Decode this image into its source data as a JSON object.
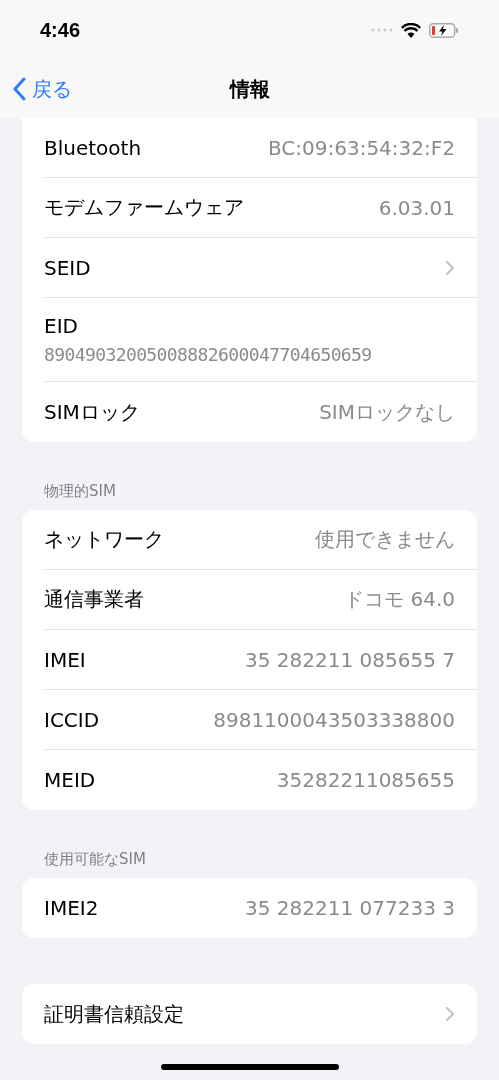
{
  "status_bar": {
    "time": "4:46"
  },
  "nav": {
    "back": "戻る",
    "title": "情報"
  },
  "sections": [
    {
      "cut_top": true,
      "rows": [
        {
          "kind": "value",
          "label": "Bluetooth",
          "value": "BC:09:63:54:32:F2"
        },
        {
          "kind": "value",
          "label": "モデムファームウェア",
          "value": "6.03.01"
        },
        {
          "kind": "chevron",
          "label": "SEID"
        },
        {
          "kind": "stacked",
          "label": "EID",
          "value": "89049032005008882600047704650659"
        },
        {
          "kind": "value",
          "label": "SIMロック",
          "value": "SIMロックなし"
        }
      ]
    },
    {
      "header": "物理的SIM",
      "cut_top": false,
      "rows": [
        {
          "kind": "value",
          "label": "ネットワーク",
          "value": "使用できません"
        },
        {
          "kind": "value",
          "label": "通信事業者",
          "value": "ドコモ 64.0"
        },
        {
          "kind": "value",
          "label": "IMEI",
          "value": "35 282211 085655 7"
        },
        {
          "kind": "value",
          "label": "ICCID",
          "value": "8981100043503338800"
        },
        {
          "kind": "value",
          "label": "MEID",
          "value": "35282211085655"
        }
      ]
    },
    {
      "header": "使用可能なSIM",
      "cut_top": false,
      "rows": [
        {
          "kind": "value",
          "label": "IMEI2",
          "value": "35 282211 077233 3"
        }
      ]
    },
    {
      "cut_top": false,
      "rows": [
        {
          "kind": "chevron",
          "label": "証明書信頼設定"
        }
      ]
    }
  ]
}
